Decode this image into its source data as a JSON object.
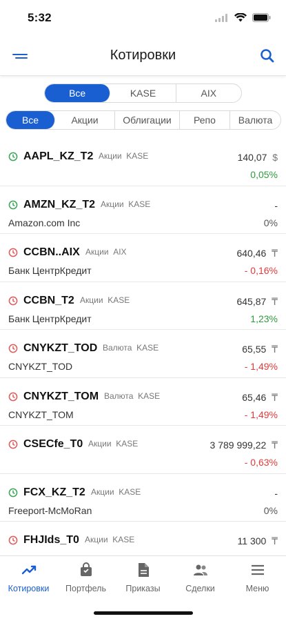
{
  "status": {
    "time": "5:32"
  },
  "header": {
    "title": "Котировки"
  },
  "exchange_filter": [
    "Все",
    "KASE",
    "AIX"
  ],
  "type_filter": [
    "Все",
    "Акции",
    "Облигации",
    "Репо",
    "Валюта"
  ],
  "quotes": [
    {
      "ticker": "AAPL_KZ_T2",
      "type": "Акции",
      "exchange": "KASE",
      "name": "",
      "price": "140,07",
      "currency": "$",
      "change": "0,05%",
      "direction": "up",
      "clock": "green"
    },
    {
      "ticker": "AMZN_KZ_T2",
      "type": "Акции",
      "exchange": "KASE",
      "name": "Amazon.com Inc",
      "price": "-",
      "currency": "",
      "change": "0%",
      "direction": "flat",
      "clock": "green"
    },
    {
      "ticker": "CCBN..AIX",
      "type": "Акции",
      "exchange": "AIX",
      "name": "Банк ЦентрКредит",
      "price": "640,46",
      "currency": "₸",
      "change": "- 0,16%",
      "direction": "down",
      "clock": "red"
    },
    {
      "ticker": "CCBN_T2",
      "type": "Акции",
      "exchange": "KASE",
      "name": "Банк ЦентрКредит",
      "price": "645,87",
      "currency": "₸",
      "change": "1,23%",
      "direction": "up",
      "clock": "red"
    },
    {
      "ticker": "CNYKZT_TOD",
      "type": "Валюта",
      "exchange": "KASE",
      "name": "CNYKZT_TOD",
      "price": "65,55",
      "currency": "₸",
      "change": "- 1,49%",
      "direction": "down",
      "clock": "red"
    },
    {
      "ticker": "CNYKZT_TOM",
      "type": "Валюта",
      "exchange": "KASE",
      "name": "CNYKZT_TOM",
      "price": "65,46",
      "currency": "₸",
      "change": "- 1,49%",
      "direction": "down",
      "clock": "red"
    },
    {
      "ticker": "CSECfe_T0",
      "type": "Акции",
      "exchange": "KASE",
      "name": "",
      "price": "3 789 999,22",
      "currency": "₸",
      "change": "- 0,63%",
      "direction": "down",
      "clock": "red"
    },
    {
      "ticker": "FCX_KZ_T2",
      "type": "Акции",
      "exchange": "KASE",
      "name": "Freeport-McMoRan",
      "price": "-",
      "currency": "",
      "change": "0%",
      "direction": "flat",
      "clock": "green"
    },
    {
      "ticker": "FHJIds_T0",
      "type": "Акции",
      "exchange": "KASE",
      "name": "",
      "price": "11 300",
      "currency": "₸",
      "change": "",
      "direction": "flat",
      "clock": "red"
    }
  ],
  "tabs": [
    {
      "label": "Котировки",
      "icon": "chart-trend-icon",
      "active": true
    },
    {
      "label": "Портфель",
      "icon": "bag-icon",
      "active": false
    },
    {
      "label": "Приказы",
      "icon": "document-icon",
      "active": false
    },
    {
      "label": "Сделки",
      "icon": "people-icon",
      "active": false
    },
    {
      "label": "Меню",
      "icon": "menu-icon",
      "active": false
    }
  ],
  "colors": {
    "accent": "#1a5fd1",
    "positive": "#2e9b3f",
    "negative": "#e23b3b",
    "clock_green": "#3aa655",
    "clock_red": "#e05a5a"
  }
}
